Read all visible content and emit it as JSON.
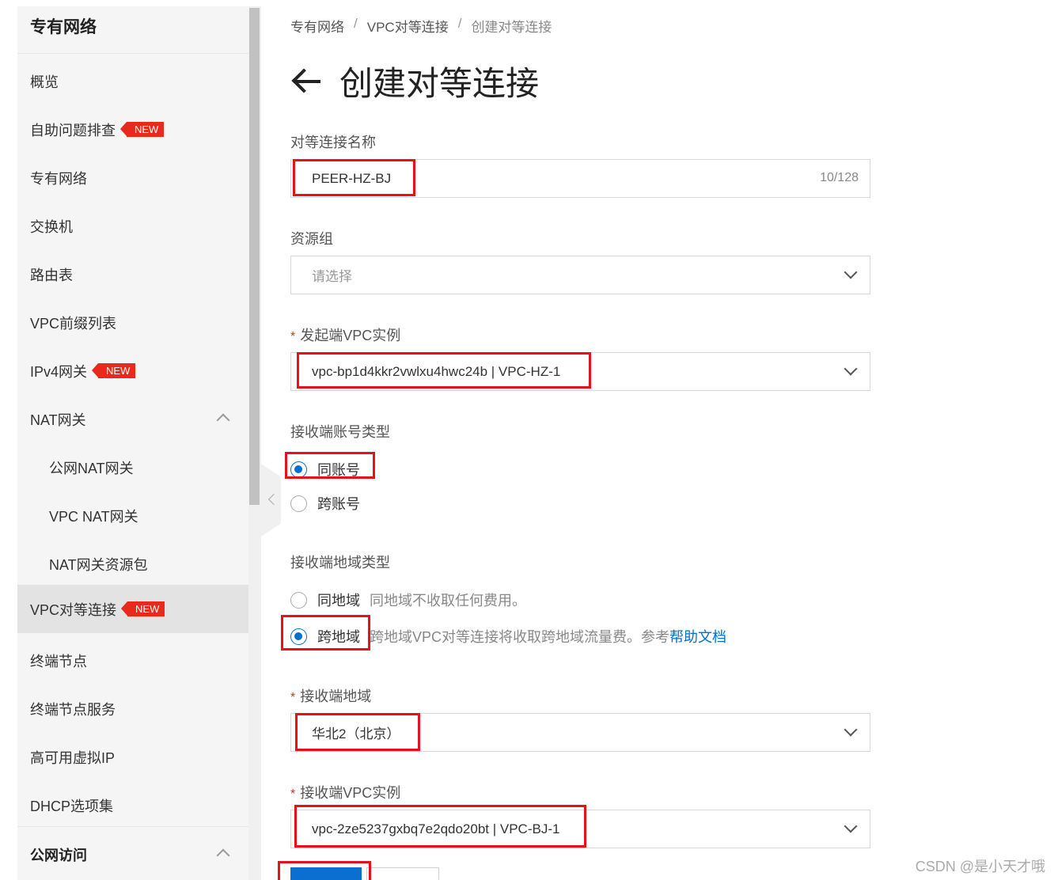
{
  "sidebar": {
    "title": "专有网络",
    "items": [
      {
        "label": "概览"
      },
      {
        "label": "自助问题排查",
        "badge": "NEW"
      },
      {
        "label": "专有网络"
      },
      {
        "label": "交换机"
      },
      {
        "label": "路由表"
      },
      {
        "label": "VPC前缀列表"
      },
      {
        "label": "IPv4网关",
        "badge": "NEW"
      },
      {
        "label": "NAT网关"
      },
      {
        "label": "公网NAT网关"
      },
      {
        "label": "VPC NAT网关"
      },
      {
        "label": "NAT网关资源包"
      },
      {
        "label": "VPC对等连接",
        "badge": "NEW"
      },
      {
        "label": "终端节点"
      },
      {
        "label": "终端节点服务"
      },
      {
        "label": "高可用虚拟IP"
      },
      {
        "label": "DHCP选项集"
      },
      {
        "label": "公网访问"
      }
    ]
  },
  "breadcrumb": [
    "专有网络",
    "VPC对等连接",
    "创建对等连接"
  ],
  "breadcrumb_sep": "/",
  "page_title": "创建对等连接",
  "form": {
    "name": {
      "label": "对等连接名称",
      "value": "PEER-HZ-BJ",
      "counter": "10/128"
    },
    "resource_group": {
      "label": "资源组",
      "placeholder": "请选择"
    },
    "initiator_vpc": {
      "required_mark": "*",
      "label": "发起端VPC实例",
      "value": "vpc-bp1d4kkr2vwlxu4hwc24b | VPC-HZ-1"
    },
    "account_type": {
      "label": "接收端账号类型",
      "options": [
        "同账号",
        "跨账号"
      ],
      "selected": "同账号"
    },
    "region_type": {
      "label": "接收端地域类型",
      "options": [
        {
          "label": "同地域",
          "desc": "同地域不收取任何费用。"
        },
        {
          "label": "跨地域",
          "desc": "跨地域VPC对等连接将收取跨地域流量费。参考",
          "link": "帮助文档"
        }
      ],
      "selected": "跨地域"
    },
    "accepter_region": {
      "required_mark": "*",
      "label": "接收端地域",
      "value": "华北2（北京）"
    },
    "accepter_vpc": {
      "required_mark": "*",
      "label": "接收端VPC实例",
      "value": "vpc-2ze5237gxbq7e2qdo20bt | VPC-BJ-1"
    }
  },
  "watermark": "CSDN @是小天才哦",
  "colors": {
    "accent": "#0070cc",
    "badge": "#e8291c",
    "highlight": "#e8101a"
  }
}
